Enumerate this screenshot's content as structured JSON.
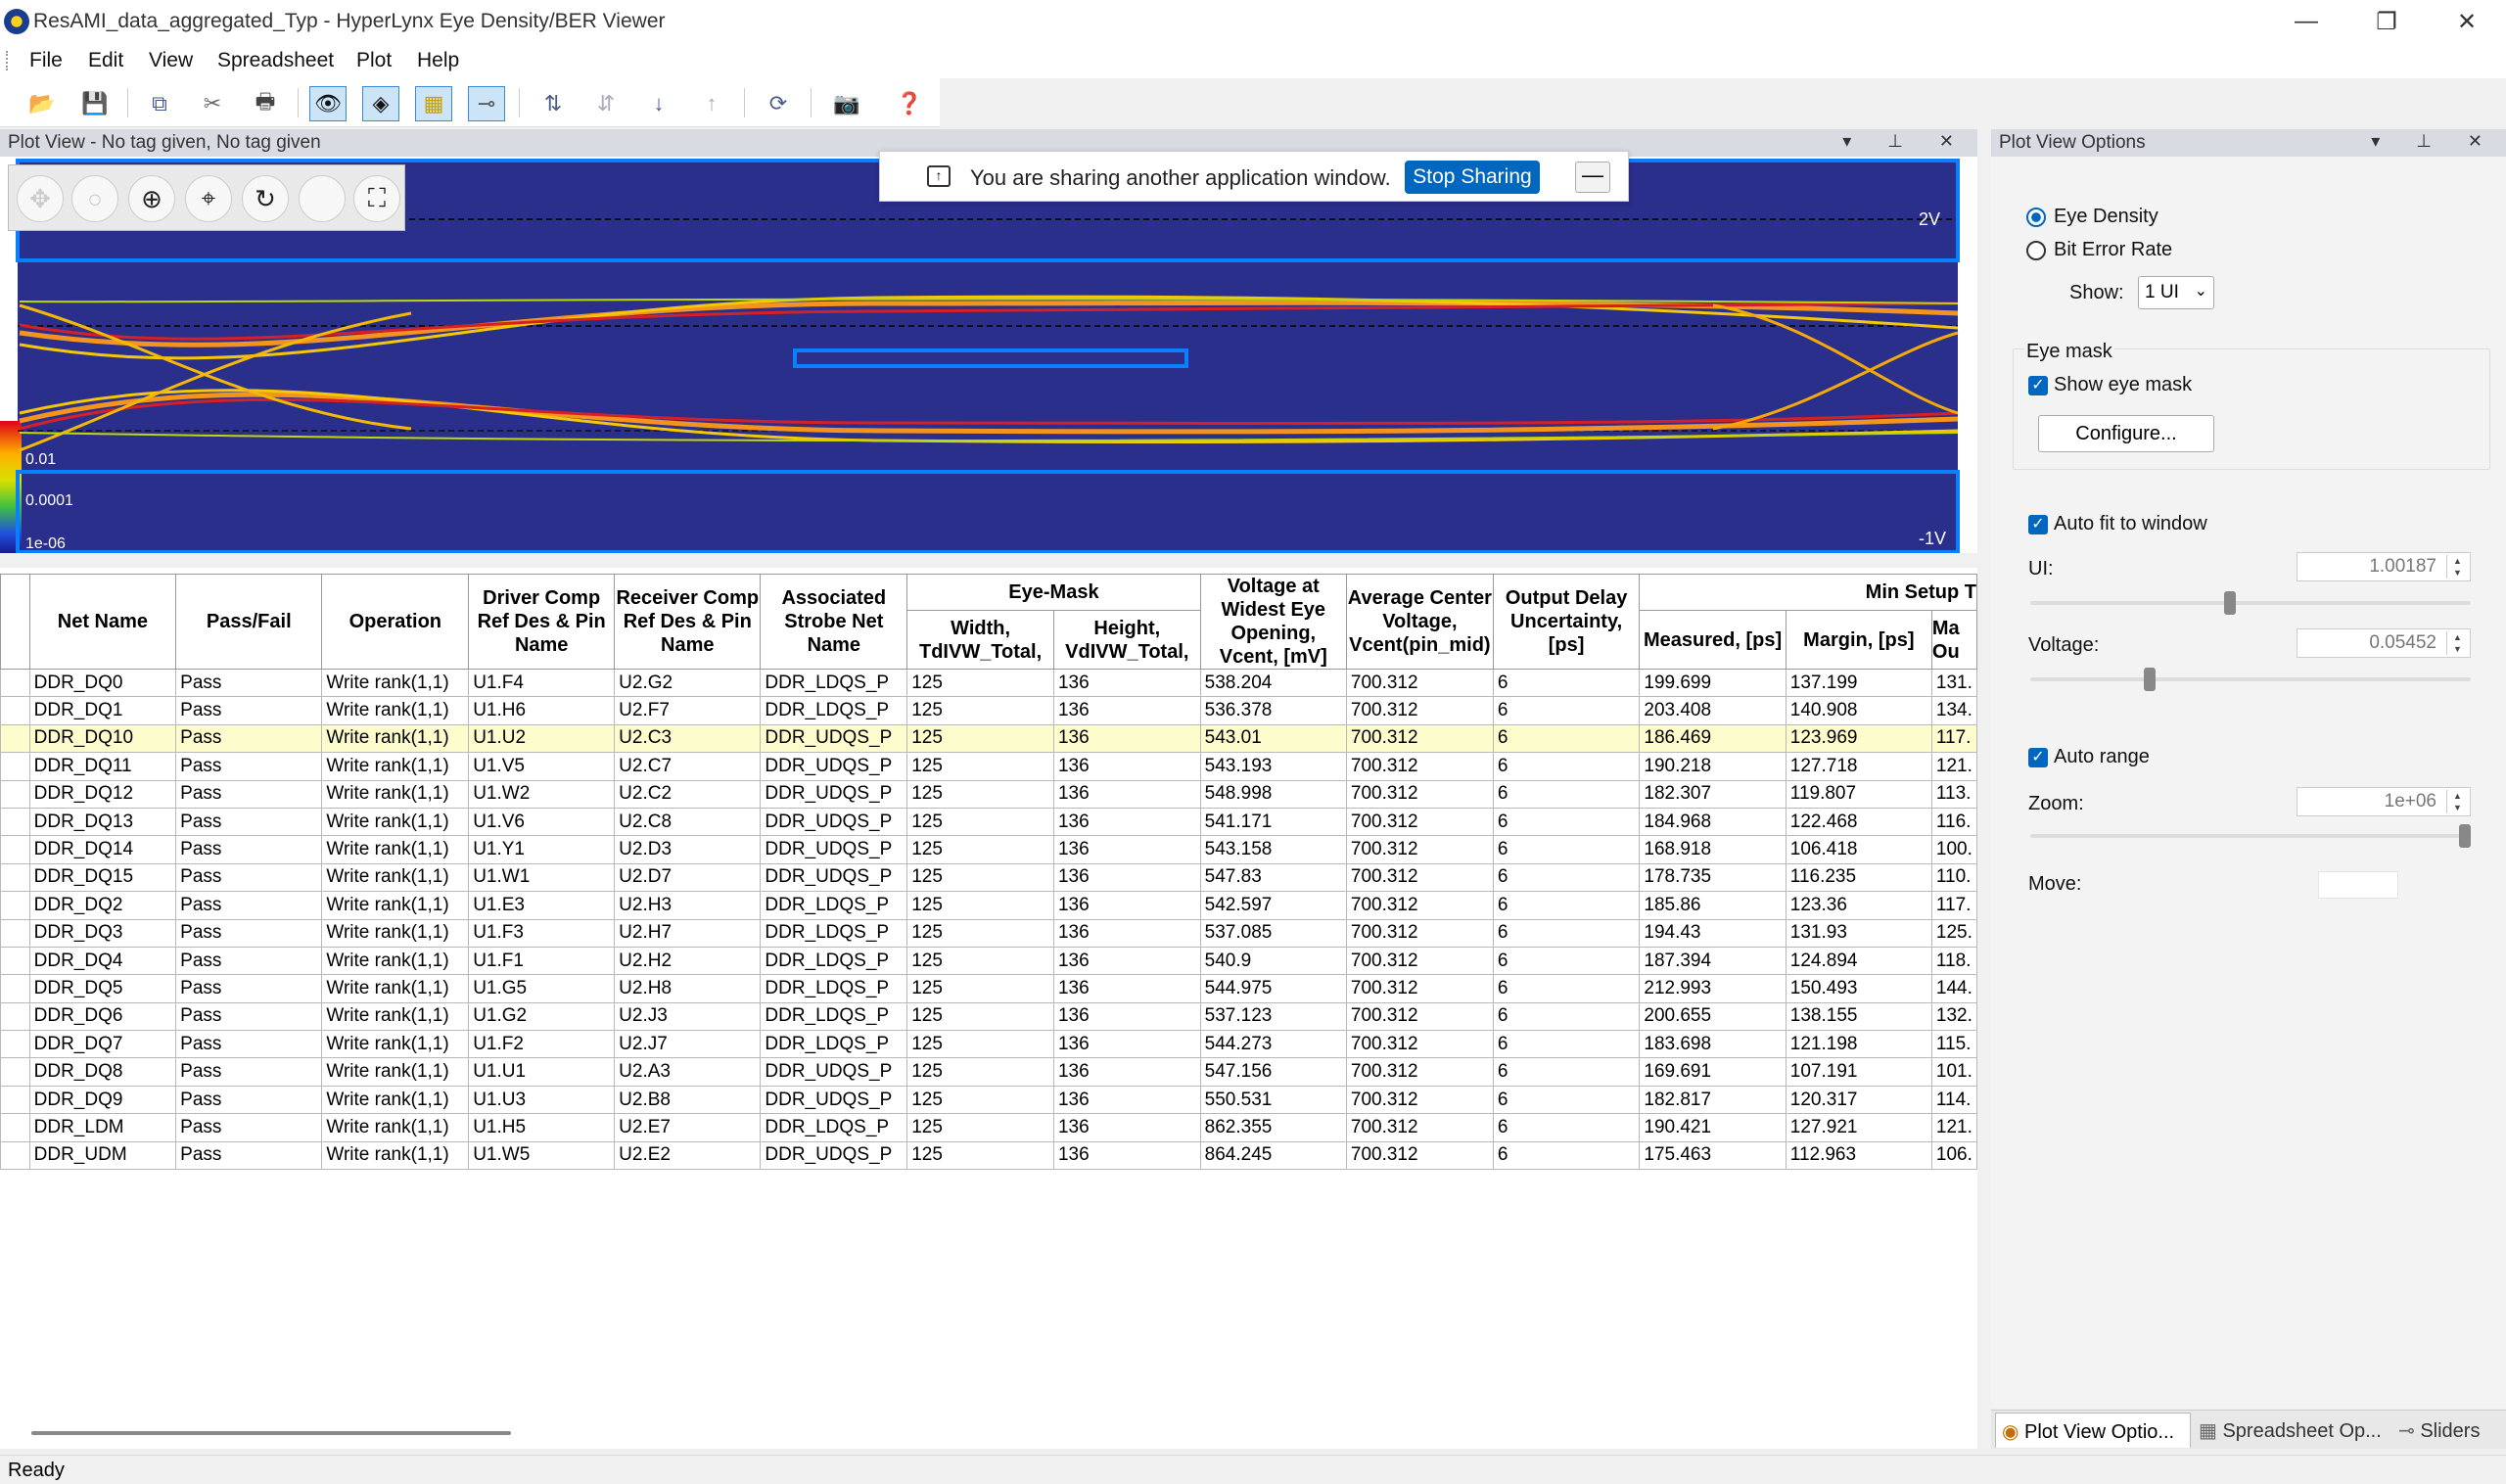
{
  "window": {
    "title": "ResAMI_data_aggregated_Typ - HyperLynx Eye Density/BER Viewer",
    "minimize": "—",
    "restore": "❐",
    "close": "✕"
  },
  "menu": [
    "File",
    "Edit",
    "View",
    "Spreadsheet",
    "Plot",
    "Help"
  ],
  "toolbar_icons": [
    "open-icon",
    "save-icon",
    "copy-icon",
    "cut-icon",
    "print-icon",
    "eye-icon",
    "eye-settings-icon",
    "mask-icon",
    "probe-icon",
    "sort-icon",
    "sort-alt-icon",
    "sort-down-icon",
    "sort-up-icon",
    "refresh-icon",
    "camera-icon",
    "help-icon"
  ],
  "plot_view": {
    "title": "Plot View - No tag given, No tag given",
    "y_label_top": "2V",
    "y_label_bottom": "-1V",
    "legend": [
      "0.01",
      "0.0001",
      "1e-06"
    ],
    "tools": [
      "pan-icon",
      "zoom-icon",
      "move-icon",
      "crosshair-icon",
      "reset-icon",
      "blank-icon",
      "fit-icon"
    ]
  },
  "share_banner": {
    "message": "You are sharing another application window.",
    "stop_label": "Stop Sharing",
    "minimize": "—"
  },
  "table": {
    "headers_row1": [
      "Net Name",
      "Pass/Fail",
      "Operation",
      "Driver Comp Ref Des & Pin Name",
      "Receiver Comp Ref Des & Pin Name",
      "Associated Strobe Net Name",
      "Eye-Mask",
      "Voltage at Widest Eye Opening, Vcent, [mV]",
      "Average Center Voltage, Vcent(pin_mid)",
      "Output Delay Uncertainty, [ps]",
      "Min Setup T"
    ],
    "headers_row2": [
      "Width, TdIVW_Total,",
      "Height, VdIVW_Total,",
      "Measured, [ps]",
      "Margin, [ps]",
      "Ma Ou"
    ],
    "rows": [
      [
        "DDR_DQ0",
        "Pass",
        "Write rank(1,1)",
        "U1.F4",
        "U2.G2",
        "DDR_LDQS_P",
        "125",
        "136",
        "538.204",
        "700.312",
        "6",
        "199.699",
        "137.199",
        "131."
      ],
      [
        "DDR_DQ1",
        "Pass",
        "Write rank(1,1)",
        "U1.H6",
        "U2.F7",
        "DDR_LDQS_P",
        "125",
        "136",
        "536.378",
        "700.312",
        "6",
        "203.408",
        "140.908",
        "134."
      ],
      [
        "DDR_DQ10",
        "Pass",
        "Write rank(1,1)",
        "U1.U2",
        "U2.C3",
        "DDR_UDQS_P",
        "125",
        "136",
        "543.01",
        "700.312",
        "6",
        "186.469",
        "123.969",
        "117."
      ],
      [
        "DDR_DQ11",
        "Pass",
        "Write rank(1,1)",
        "U1.V5",
        "U2.C7",
        "DDR_UDQS_P",
        "125",
        "136",
        "543.193",
        "700.312",
        "6",
        "190.218",
        "127.718",
        "121."
      ],
      [
        "DDR_DQ12",
        "Pass",
        "Write rank(1,1)",
        "U1.W2",
        "U2.C2",
        "DDR_UDQS_P",
        "125",
        "136",
        "548.998",
        "700.312",
        "6",
        "182.307",
        "119.807",
        "113."
      ],
      [
        "DDR_DQ13",
        "Pass",
        "Write rank(1,1)",
        "U1.V6",
        "U2.C8",
        "DDR_UDQS_P",
        "125",
        "136",
        "541.171",
        "700.312",
        "6",
        "184.968",
        "122.468",
        "116."
      ],
      [
        "DDR_DQ14",
        "Pass",
        "Write rank(1,1)",
        "U1.Y1",
        "U2.D3",
        "DDR_UDQS_P",
        "125",
        "136",
        "543.158",
        "700.312",
        "6",
        "168.918",
        "106.418",
        "100."
      ],
      [
        "DDR_DQ15",
        "Pass",
        "Write rank(1,1)",
        "U1.W1",
        "U2.D7",
        "DDR_UDQS_P",
        "125",
        "136",
        "547.83",
        "700.312",
        "6",
        "178.735",
        "116.235",
        "110."
      ],
      [
        "DDR_DQ2",
        "Pass",
        "Write rank(1,1)",
        "U1.E3",
        "U2.H3",
        "DDR_LDQS_P",
        "125",
        "136",
        "542.597",
        "700.312",
        "6",
        "185.86",
        "123.36",
        "117."
      ],
      [
        "DDR_DQ3",
        "Pass",
        "Write rank(1,1)",
        "U1.F3",
        "U2.H7",
        "DDR_LDQS_P",
        "125",
        "136",
        "537.085",
        "700.312",
        "6",
        "194.43",
        "131.93",
        "125."
      ],
      [
        "DDR_DQ4",
        "Pass",
        "Write rank(1,1)",
        "U1.F1",
        "U2.H2",
        "DDR_LDQS_P",
        "125",
        "136",
        "540.9",
        "700.312",
        "6",
        "187.394",
        "124.894",
        "118."
      ],
      [
        "DDR_DQ5",
        "Pass",
        "Write rank(1,1)",
        "U1.G5",
        "U2.H8",
        "DDR_LDQS_P",
        "125",
        "136",
        "544.975",
        "700.312",
        "6",
        "212.993",
        "150.493",
        "144."
      ],
      [
        "DDR_DQ6",
        "Pass",
        "Write rank(1,1)",
        "U1.G2",
        "U2.J3",
        "DDR_LDQS_P",
        "125",
        "136",
        "537.123",
        "700.312",
        "6",
        "200.655",
        "138.155",
        "132."
      ],
      [
        "DDR_DQ7",
        "Pass",
        "Write rank(1,1)",
        "U1.F2",
        "U2.J7",
        "DDR_LDQS_P",
        "125",
        "136",
        "544.273",
        "700.312",
        "6",
        "183.698",
        "121.198",
        "115."
      ],
      [
        "DDR_DQ8",
        "Pass",
        "Write rank(1,1)",
        "U1.U1",
        "U2.A3",
        "DDR_UDQS_P",
        "125",
        "136",
        "547.156",
        "700.312",
        "6",
        "169.691",
        "107.191",
        "101."
      ],
      [
        "DDR_DQ9",
        "Pass",
        "Write rank(1,1)",
        "U1.U3",
        "U2.B8",
        "DDR_UDQS_P",
        "125",
        "136",
        "550.531",
        "700.312",
        "6",
        "182.817",
        "120.317",
        "114."
      ],
      [
        "DDR_LDM",
        "Pass",
        "Write rank(1,1)",
        "U1.H5",
        "U2.E7",
        "DDR_LDQS_P",
        "125",
        "136",
        "862.355",
        "700.312",
        "6",
        "190.421",
        "127.921",
        "121."
      ],
      [
        "DDR_UDM",
        "Pass",
        "Write rank(1,1)",
        "U1.W5",
        "U2.E2",
        "DDR_UDQS_P",
        "125",
        "136",
        "864.245",
        "700.312",
        "6",
        "175.463",
        "112.963",
        "106."
      ]
    ],
    "selected_row": 2
  },
  "options_panel": {
    "title": "Plot View Options",
    "eye_density": "Eye Density",
    "bit_error_rate": "Bit Error Rate",
    "show_label": "Show:",
    "show_value": "1 UI",
    "eye_mask_group": "Eye mask",
    "show_eye_mask": "Show eye mask",
    "configure": "Configure...",
    "auto_fit": "Auto fit to window",
    "ui_label": "UI:",
    "ui_value": "1.00187",
    "voltage_label": "Voltage:",
    "voltage_value": "0.05452",
    "auto_range": "Auto range",
    "zoom_label": "Zoom:",
    "zoom_value": "1e+06",
    "move_label": "Move:"
  },
  "bottom_tabs": [
    "Plot View Optio...",
    "Spreadsheet Op...",
    "Sliders"
  ],
  "status": "Ready"
}
